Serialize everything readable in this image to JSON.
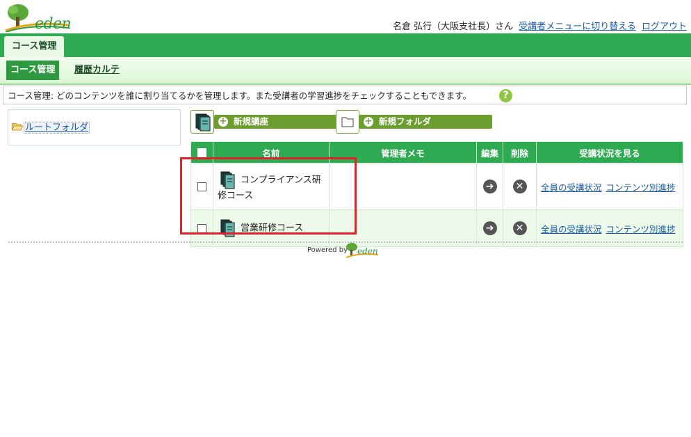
{
  "brand": {
    "name": "eden",
    "accent": "#2eab52",
    "dark_green": "#2e9a3f"
  },
  "user": {
    "name": "名倉 弘行（大阪支社長）さん",
    "switch_link": "受講者メニューに切り替える",
    "logout_link": "ログアウト"
  },
  "main_tab": {
    "label": "コース管理"
  },
  "subnav": {
    "active": "コース管理",
    "link": "履歴カルテ"
  },
  "info": {
    "text": "コース管理: どのコンテンツを誰に割り当てるかを管理します。また受講者の学習進捗をチェックすることもできます。",
    "help_icon": "question-icon"
  },
  "tree": {
    "root": "ルートフォルダ"
  },
  "toolbar": {
    "new_course": "新規講座",
    "new_folder": "新規フォルダ"
  },
  "table": {
    "headers": {
      "name": "名前",
      "memo": "管理者メモ",
      "edit": "編集",
      "delete": "削除",
      "status": "受講状況を見る"
    },
    "rows": [
      {
        "name": "コンプライアンス研修コース",
        "memo": "",
        "all_status": "全員の受講状況",
        "content_progress": "コンテンツ別進捗"
      },
      {
        "name": "営業研修コース",
        "memo": "",
        "all_status": "全員の受講状況",
        "content_progress": "コンテンツ別進捗"
      }
    ]
  },
  "footer": {
    "powered_by": "Powered by",
    "logo": "eden"
  }
}
